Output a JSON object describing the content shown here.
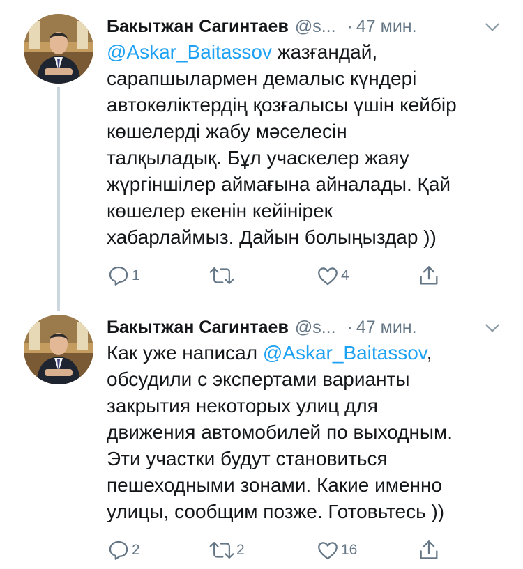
{
  "tweets": [
    {
      "author_name": "Бакытжан Сагинтаев",
      "author_handle": "@s...",
      "separator": "·",
      "time": "47 мин.",
      "lines": [
        {
          "mention": "@Askar_Baitassov",
          "text": " жазғандай,"
        },
        {
          "mention": "",
          "text": "сарапшылармен демалыс күндері"
        },
        {
          "mention": "",
          "text": "автокөліктердің қозғалысы үшін кейбір"
        },
        {
          "mention": "",
          "text": "көшелерді жабу мәселесін"
        },
        {
          "mention": "",
          "text": "талқыладық. Бұл учаскелер жаяу"
        },
        {
          "mention": "",
          "text": "жүргіншілер аймағына айналады. Қай"
        },
        {
          "mention": "",
          "text": "көшелер екенін кейінірек"
        },
        {
          "mention": "",
          "text": "хабарлаймыз. Дайын болыңыздар ))"
        }
      ],
      "replies": "1",
      "retweets": "",
      "likes": "4"
    },
    {
      "author_name": "Бакытжан Сагинтаев",
      "author_handle": "@s...",
      "separator": "·",
      "time": "47 мин.",
      "lines": [
        {
          "text": "Как уже написал ",
          "mention": "@Askar_Baitassov",
          "text2": ","
        },
        {
          "text": "обсудили с экспертами варианты",
          "mention": "",
          "text2": ""
        },
        {
          "text": "закрытия некоторых улиц для",
          "mention": "",
          "text2": ""
        },
        {
          "text": "движения автомобилей по выходным.",
          "mention": "",
          "text2": ""
        },
        {
          "text": "Эти участки будут становиться",
          "mention": "",
          "text2": ""
        },
        {
          "text": "пешеходными зонами. Какие именно",
          "mention": "",
          "text2": ""
        },
        {
          "text": "улицы, сообщим позже. Готовьтесь ))",
          "mention": "",
          "text2": ""
        }
      ],
      "replies": "2",
      "retweets": "2",
      "likes": "16"
    }
  ],
  "icons": {
    "reply": "reply-icon",
    "retweet": "retweet-icon",
    "like": "heart-icon",
    "share": "share-icon",
    "more": "chevron-down-icon"
  },
  "colors": {
    "text": "#14171a",
    "secondary": "#657786",
    "link": "#1da1f2",
    "thread_line": "#ccd6dd"
  }
}
